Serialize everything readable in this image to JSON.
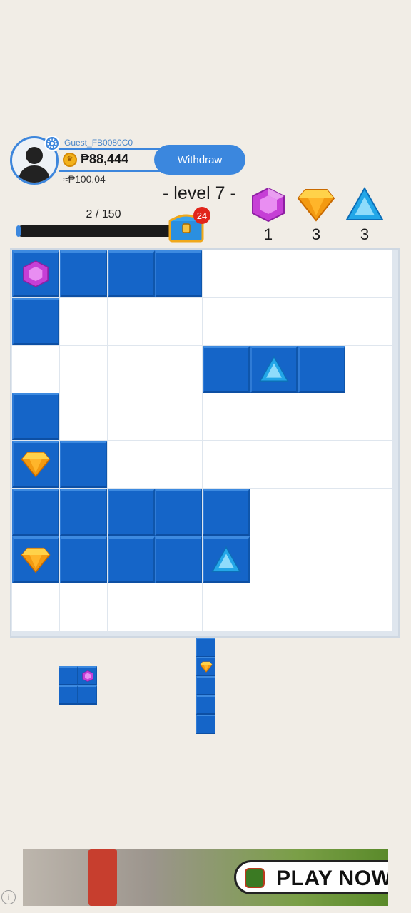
{
  "profile": {
    "username": "Guest_FB0080C0",
    "coins": "₱88,444",
    "cash_value": "≈₱100.04",
    "withdraw_label": "Withdraw"
  },
  "level": {
    "title": "- level 7 -",
    "progress_text": "2 / 150",
    "progress_fraction": 0.013,
    "chest_badge": "24"
  },
  "goals": [
    {
      "gem": "purple-hexagon",
      "count": "1"
    },
    {
      "gem": "orange-diamond",
      "count": "3"
    },
    {
      "gem": "blue-triangle",
      "count": "3"
    }
  ],
  "board": {
    "rows": 8,
    "cols": 8,
    "cells": [
      "PBBB....",
      "B.......",
      "....BTB.",
      "B.......",
      "OB......",
      "BBBBB...",
      "OBBBT...",
      "........"
    ],
    "legend": {
      "B": "blue-block",
      "P": "purple-gem-block",
      "O": "orange-gem-block",
      "T": "blue-triangle-gem-block",
      ".": "empty"
    }
  },
  "pieces": [
    {
      "shape": [
        "BP",
        "BB"
      ]
    },
    {
      "shape": [
        "B",
        "O",
        "B",
        "B",
        "B"
      ]
    }
  ],
  "ad": {
    "cta": "PLAY NOW",
    "info": "i"
  },
  "colors": {
    "background": "#f1ede6",
    "accent": "#3b87de",
    "block": "#1565c8",
    "badge": "#e1251b"
  }
}
